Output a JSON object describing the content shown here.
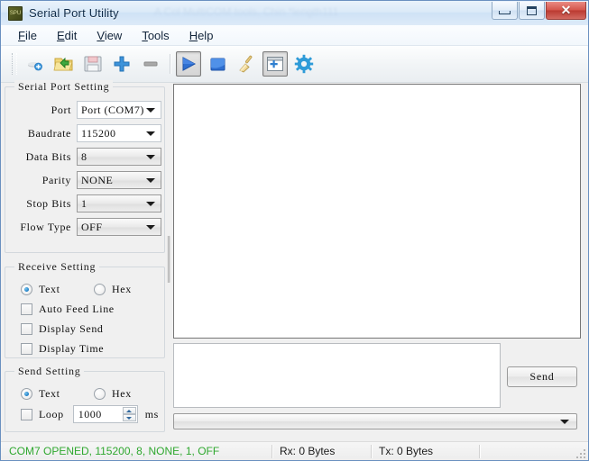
{
  "window": {
    "title": "Serial Port Utility",
    "icon_label": "SPU",
    "ghost_title": "A  Col  MultiCOM  tools,  Chin  *length111",
    "minimize_label": "Minimize",
    "maximize_label": "Maximize",
    "close_label": "✕"
  },
  "menu": [
    {
      "label": "File",
      "accel": "F",
      "rest": "ile"
    },
    {
      "label": "Edit",
      "accel": "E",
      "rest": "dit"
    },
    {
      "label": "View",
      "accel": "V",
      "rest": "iew"
    },
    {
      "label": "Tools",
      "accel": "T",
      "rest": "ools"
    },
    {
      "label": "Help",
      "accel": "H",
      "rest": "elp"
    }
  ],
  "toolbar": [
    {
      "name": "new-port-icon",
      "tooltip": "New",
      "pressed": false
    },
    {
      "name": "open-folder-icon",
      "tooltip": "Open",
      "pressed": false
    },
    {
      "name": "save-icon",
      "tooltip": "Save",
      "pressed": false
    },
    {
      "name": "add-icon",
      "tooltip": "Add",
      "pressed": false
    },
    {
      "name": "remove-icon",
      "tooltip": "Remove",
      "pressed": false
    },
    {
      "name": "play-icon",
      "tooltip": "Open Port",
      "pressed": true
    },
    {
      "name": "stop-icon",
      "tooltip": "Close Port",
      "pressed": false
    },
    {
      "name": "broom-icon",
      "tooltip": "Clear",
      "pressed": false
    },
    {
      "name": "new-window-icon",
      "tooltip": "New Window",
      "pressed": true
    },
    {
      "name": "gear-icon",
      "tooltip": "Settings",
      "pressed": false
    }
  ],
  "serial_port_setting": {
    "title": "Serial Port Setting",
    "fields": [
      {
        "label": "Port",
        "value": "Port (COM7)",
        "enabled": true
      },
      {
        "label": "Baudrate",
        "value": "115200",
        "enabled": true
      },
      {
        "label": "Data Bits",
        "value": "8",
        "enabled": false
      },
      {
        "label": "Parity",
        "value": "NONE",
        "enabled": false
      },
      {
        "label": "Stop Bits",
        "value": "1",
        "enabled": false
      },
      {
        "label": "Flow Type",
        "value": "OFF",
        "enabled": false
      }
    ]
  },
  "receive_setting": {
    "title": "Receive Setting",
    "mode_text": "Text",
    "mode_hex": "Hex",
    "mode_selected": "Text",
    "checks": [
      {
        "label": "Auto Feed Line",
        "checked": false
      },
      {
        "label": "Display Send",
        "checked": false
      },
      {
        "label": "Display Time",
        "checked": false
      }
    ]
  },
  "send_setting": {
    "title": "Send Setting",
    "mode_text": "Text",
    "mode_hex": "Hex",
    "mode_selected": "Text",
    "loop_label": "Loop",
    "loop_checked": false,
    "loop_value": "1000",
    "loop_unit": "ms"
  },
  "main": {
    "receive_text": "",
    "send_text": "",
    "send_button": "Send",
    "history_value": ""
  },
  "statusbar": {
    "connection": "COM7 OPENED, 115200, 8, NONE, 1, OFF",
    "rx": "Rx: 0 Bytes",
    "tx": "Tx: 0 Bytes",
    "extra": ""
  },
  "colors": {
    "status_green": "#2fa82f",
    "accent_blue": "#1a7cc4",
    "close_red": "#c0392b"
  }
}
